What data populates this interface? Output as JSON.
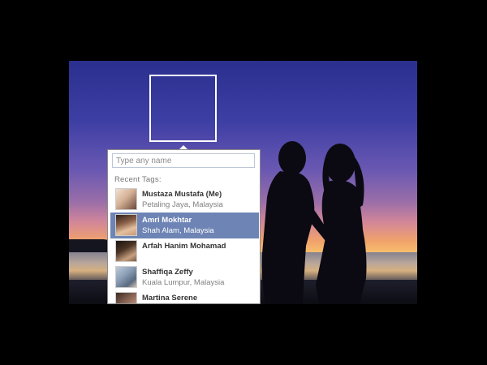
{
  "tag_dialog": {
    "search": {
      "placeholder": "Type any name",
      "value": ""
    },
    "recent_label": "Recent Tags:",
    "people": [
      {
        "name": "Mustaza Mustafa (Me)",
        "location": "Petaling Jaya, Malaysia",
        "selected": false
      },
      {
        "name": "Amri Mokhtar",
        "location": "Shah Alam, Malaysia",
        "selected": true
      },
      {
        "name": "Arfah Hanim Mohamad",
        "location": "",
        "selected": false
      },
      {
        "name": "Shaffiqa Zeffy",
        "location": "Kuala Lumpur, Malaysia",
        "selected": false
      },
      {
        "name": "Martina Serene",
        "location": "",
        "selected": false
      }
    ]
  },
  "colors": {
    "selected_row": "#6d84b4",
    "input_border": "#bdc7d8",
    "backdrop": "#000000"
  }
}
